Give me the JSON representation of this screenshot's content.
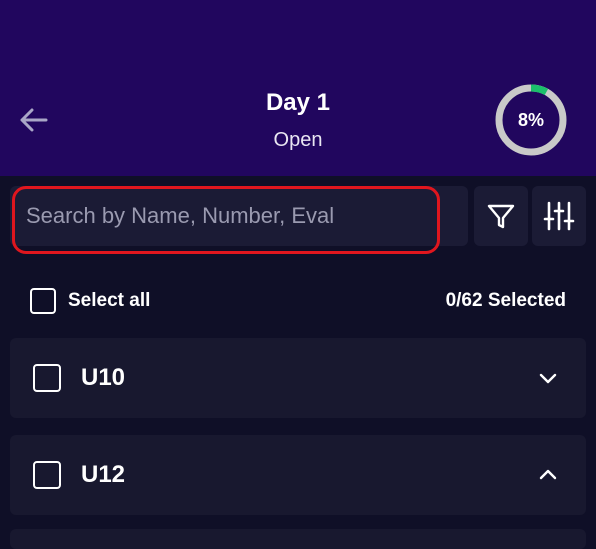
{
  "header": {
    "title": "Day 1",
    "subtitle": "Open",
    "progress_label": "8%",
    "progress_value": 0.08
  },
  "search": {
    "placeholder": "Search by Name, Number, Eval",
    "value": ""
  },
  "toolbar": {
    "filter_icon": "filter-icon",
    "settings_icon": "sliders-icon"
  },
  "selection": {
    "select_all_label": "Select all",
    "selected_count": "0/62 Selected"
  },
  "groups": [
    {
      "label": "U10",
      "expanded": false,
      "chevron_icon": "chevron-down-icon"
    },
    {
      "label": "U12",
      "expanded": true,
      "chevron_icon": "chevron-up-icon"
    }
  ],
  "colors": {
    "header_bg": "#21065e",
    "page_bg": "#0f0f27",
    "panel_bg": "#18182f",
    "progress_accent": "#1bbf6b",
    "progress_track": "#c9c9c9",
    "highlight": "#e0161e",
    "caret": "#2ac2b3"
  }
}
